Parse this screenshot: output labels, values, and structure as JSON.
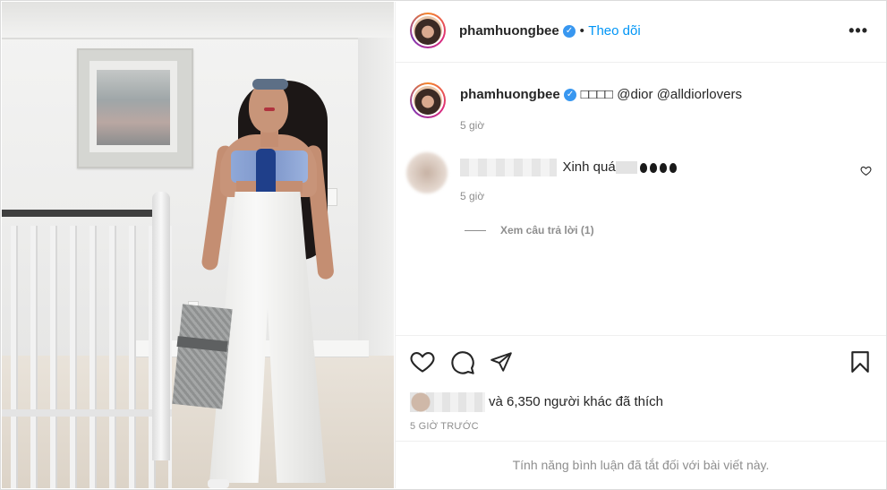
{
  "post": {
    "username": "phamhuongbee",
    "follow_label": "Theo dõi",
    "separator": "•",
    "more_label": "•••",
    "caption_emoji": "□□□□",
    "caption_mentions": "@dior @alldiorlovers",
    "caption_time": "5 giờ"
  },
  "comment": {
    "text": "Xinh quá",
    "time": "5 giờ",
    "view_replies": "Xem câu trả lời (1)"
  },
  "likes": {
    "text": "và 6,350 người khác đã thích",
    "count": 6350
  },
  "timestamp": "5 GIỜ TRƯỚC",
  "comments_disabled": "Tính năng bình luận đã tắt đối với bài viết này.",
  "icons": {
    "like": "heart-icon",
    "comment": "comment-icon",
    "share": "share-icon",
    "save": "bookmark-icon",
    "verified": "verified-badge-icon"
  },
  "colors": {
    "link_blue": "#0095f6",
    "verified_blue": "#3897f0",
    "muted_text": "#8e8e8e",
    "primary_text": "#262626"
  }
}
